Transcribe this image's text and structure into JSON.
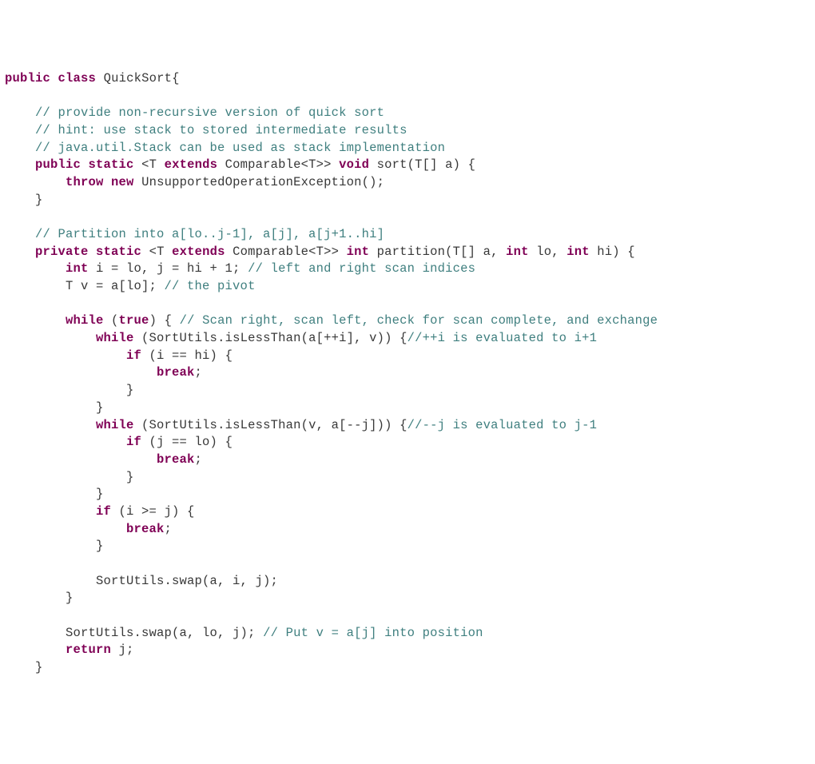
{
  "code": {
    "t01a": "public",
    "t01b": "class",
    "t01c": "QuickSort",
    "t01d": "{",
    "t03": "    // provide non-recursive version of quick sort",
    "t04": "    // hint: use stack to stored intermediate results",
    "t05": "    // java.util.Stack can be used as stack implementation",
    "t06a": "public",
    "t06b": "static",
    "t06c": " <T ",
    "t06d": "extends",
    "t06e": " Comparable<T>> ",
    "t06f": "void",
    "t06g": " sort(T[] a) {",
    "t07a": "throw",
    "t07b": "new",
    "t07c": " UnsupportedOperationException();",
    "t08a": "    }",
    "t10a": "    // Partition into a[lo..j-1], a[j], a[j+1..hi]",
    "t11a": "private",
    "t11b": "static",
    "t11c": " <T ",
    "t11d": "extends",
    "t11e": " Comparable<T>> ",
    "t11f": "int",
    "t11g": " partition(T[] a, ",
    "t11h": "int",
    "t11i": " lo, ",
    "t11j": "int",
    "t11k": " hi) {",
    "t12a": "int",
    "t12b": " i = lo, j = hi + 1; ",
    "t12c": "// left and right scan indices",
    "t13a": "        T v = a[lo]; ",
    "t13b": "// the pivot",
    "t15a": "while",
    "t15b": " (",
    "t15c": "true",
    "t15d": ") { ",
    "t15e": "// Scan right, scan left, check for scan complete, and exchange",
    "t16a": "while",
    "t16b": " (SortUtils.isLessThan(a[++i], v)) {",
    "t16c": "//++i is evaluated to i+1",
    "t17a": "if",
    "t17b": " (i == hi) {",
    "t18a": "break",
    "t18b": ";",
    "t19a": "                }",
    "t20a": "            }",
    "t21a": "while",
    "t21b": " (SortUtils.isLessThan(v, a[--j])) {",
    "t21c": "//--j is evaluated to j-1",
    "t22a": "if",
    "t22b": " (j == lo) {",
    "t23a": "break",
    "t23b": ";",
    "t24a": "                }",
    "t25a": "            }",
    "t26a": "if",
    "t26b": " (i >= j) {",
    "t27a": "break",
    "t27b": ";",
    "t28a": "            }",
    "t30a": "            SortUtils.swap(a, i, j);",
    "t31a": "        }",
    "t33a": "        SortUtils.swap(a, lo, j); ",
    "t33b": "// Put v = a[j] into position",
    "t34a": "return",
    "t34b": " j;",
    "t35a": "    }"
  }
}
